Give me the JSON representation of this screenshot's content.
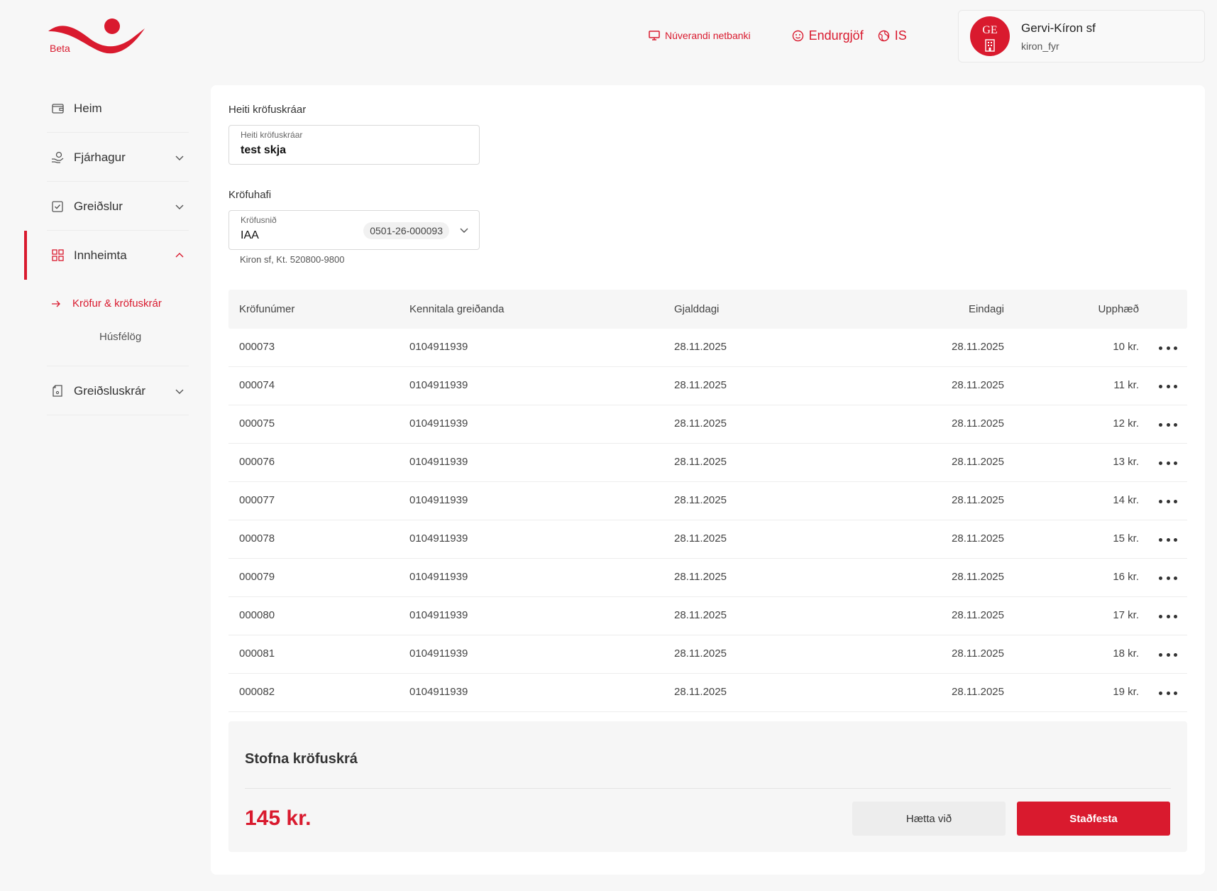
{
  "header": {
    "logo_badge": "Beta",
    "links": {
      "current_bank": "Núverandi netbanki",
      "feedback": "Endurgjöf",
      "language": "IS"
    },
    "user": {
      "initials": "GE",
      "name": "Gervi-Kíron sf",
      "handle": "kiron_fyr"
    }
  },
  "sidebar": {
    "items": [
      {
        "label": "Heim"
      },
      {
        "label": "Fjárhagur"
      },
      {
        "label": "Greiðslur"
      },
      {
        "label": "Innheimta"
      },
      {
        "label": "Greiðsluskrár"
      }
    ],
    "subitems": [
      {
        "label": "Kröfur & kröfuskrár"
      },
      {
        "label": "Húsfélög"
      }
    ]
  },
  "form": {
    "name_section_label": "Heiti kröfuskráar",
    "name_field_label": "Heiti kröfuskráar",
    "name_field_value": "test skja",
    "claimant_section_label": "Kröfuhafi",
    "template_label": "Kröfusnið",
    "template_value": "IAA",
    "template_id": "0501-26-000093",
    "claimant_helper": "Kiron sf, Kt. 520800-9800"
  },
  "table": {
    "headers": [
      "Kröfunúmer",
      "Kennitala greiðanda",
      "Gjalddagi",
      "Eindagi",
      "Upphæð"
    ],
    "rows": [
      [
        "000073",
        "0104911939",
        "28.11.2025",
        "28.11.2025",
        "10 kr."
      ],
      [
        "000074",
        "0104911939",
        "28.11.2025",
        "28.11.2025",
        "11 kr."
      ],
      [
        "000075",
        "0104911939",
        "28.11.2025",
        "28.11.2025",
        "12 kr."
      ],
      [
        "000076",
        "0104911939",
        "28.11.2025",
        "28.11.2025",
        "13 kr."
      ],
      [
        "000077",
        "0104911939",
        "28.11.2025",
        "28.11.2025",
        "14 kr."
      ],
      [
        "000078",
        "0104911939",
        "28.11.2025",
        "28.11.2025",
        "15 kr."
      ],
      [
        "000079",
        "0104911939",
        "28.11.2025",
        "28.11.2025",
        "16 kr."
      ],
      [
        "000080",
        "0104911939",
        "28.11.2025",
        "28.11.2025",
        "17 kr."
      ],
      [
        "000081",
        "0104911939",
        "28.11.2025",
        "28.11.2025",
        "18 kr."
      ],
      [
        "000082",
        "0104911939",
        "28.11.2025",
        "28.11.2025",
        "19 kr."
      ]
    ]
  },
  "summary": {
    "title": "Stofna kröfuskrá",
    "total": "145 kr.",
    "cancel_label": "Hætta við",
    "confirm_label": "Staðfesta"
  },
  "colors": {
    "brand": "#d91a2e",
    "background": "#f7f7f7"
  }
}
